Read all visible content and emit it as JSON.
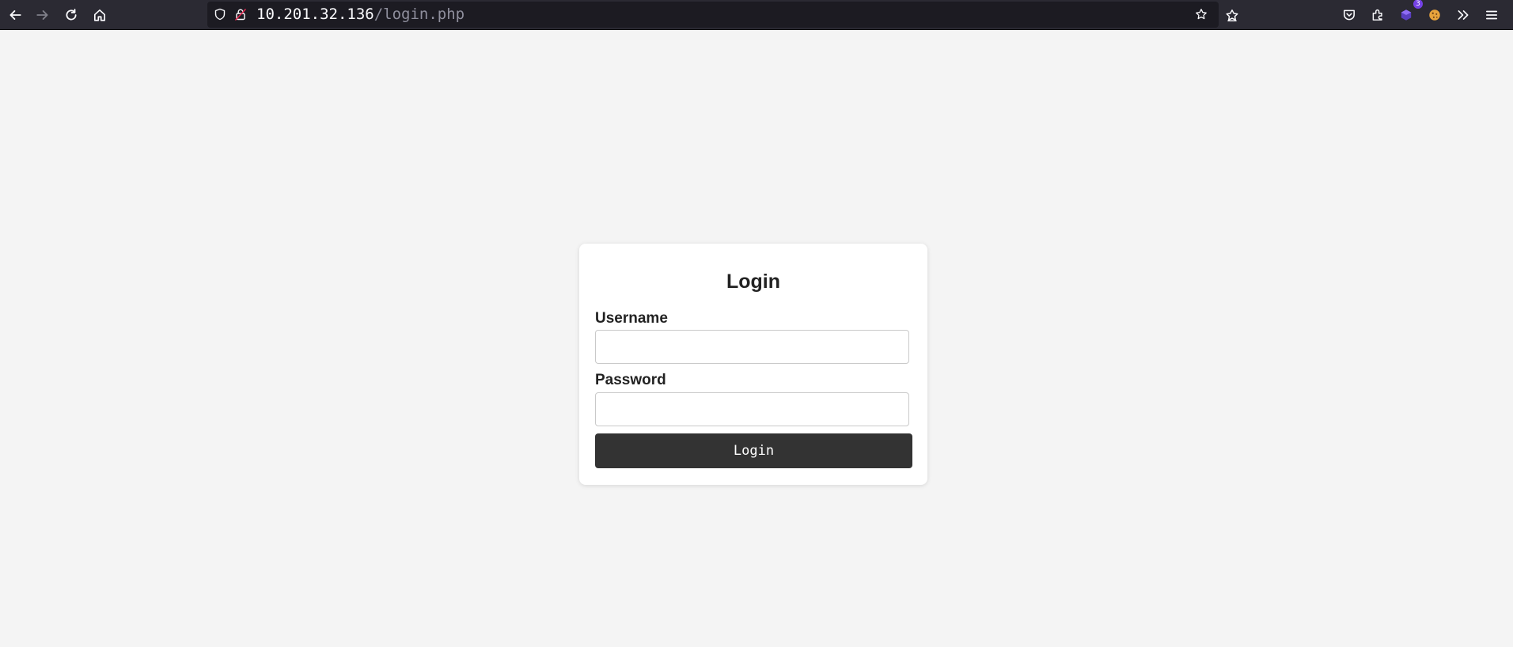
{
  "browser": {
    "toolbar_color": "#2b2a33",
    "nav_icons": [
      "back-arrow-icon",
      "forward-arrow-icon",
      "reload-icon",
      "home-icon"
    ],
    "url": {
      "host": "10.201.32.136",
      "path": "/login.php"
    },
    "extension_badge_count": "3",
    "toolbar_icons": [
      "pocket-icon",
      "extensions-icon",
      "extension-icon",
      "cookie-icon",
      "overflow-menu-icon",
      "hamburger-menu-icon"
    ]
  },
  "login": {
    "title": "Login",
    "username_label": "Username",
    "username_value": "",
    "password_label": "Password",
    "password_value": "",
    "submit_label": "Login",
    "button_color": "#333333"
  }
}
